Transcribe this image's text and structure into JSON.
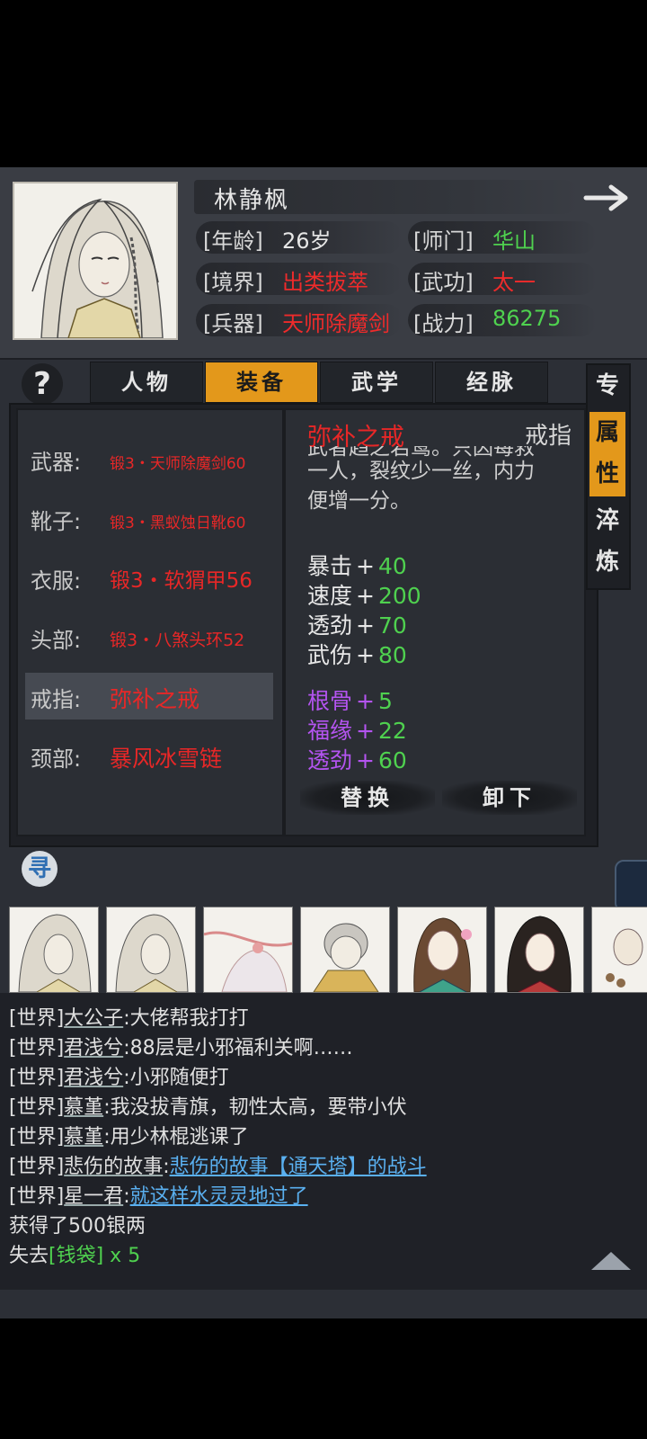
{
  "character": {
    "name": "林静枫",
    "stats": [
      {
        "label": "[年龄]",
        "value": "26岁",
        "color": "white"
      },
      {
        "label": "[师门]",
        "value": "华山",
        "color": "green"
      },
      {
        "label": "[境界]",
        "value": "出类拔萃",
        "color": "red"
      },
      {
        "label": "[武功]",
        "value": "太一",
        "color": "red"
      },
      {
        "label": "[兵器]",
        "value": "天师除魔剑",
        "color": "red"
      },
      {
        "label": "[战力]",
        "value": "86275",
        "color": "green"
      }
    ],
    "next_icon": "arrow-right-icon"
  },
  "tabs": [
    {
      "label": "人物",
      "active": false
    },
    {
      "label": "装备",
      "active": true
    },
    {
      "label": "武学",
      "active": false
    },
    {
      "label": "经脉",
      "active": false
    }
  ],
  "help_label": "?",
  "side_tabs": [
    {
      "label": "专",
      "active": false
    },
    {
      "label": "属性",
      "active": true
    },
    {
      "label": "淬炼",
      "active": false
    }
  ],
  "equipment": [
    {
      "slot": "武器:",
      "item": "锻3・天师除魔剑60"
    },
    {
      "slot": "靴子:",
      "item": "锻3・黑蚁蚀日靴60"
    },
    {
      "slot": "衣服:",
      "item": "锻3・软猬甲56"
    },
    {
      "slot": "头部:",
      "item": "锻3・八煞头环52"
    },
    {
      "slot": "戒指:",
      "item": "弥补之戒"
    },
    {
      "slot": "颈部:",
      "item": "暴风冰雪链"
    }
  ],
  "selected_slot": "戒指:",
  "detail": {
    "name": "弥补之戒",
    "type": "戒指",
    "desc_clipped": "武者趋之若鹜。只因每救",
    "desc_lines": [
      "一人，裂纹少一丝，内力",
      "便增一分。"
    ],
    "bonuses": [
      {
        "label": "暴击",
        "plus": "+",
        "value": "40"
      },
      {
        "label": "速度",
        "plus": "+",
        "value": "200"
      },
      {
        "label": "透劲",
        "plus": "+",
        "value": "70"
      },
      {
        "label": "武伤",
        "plus": "+",
        "value": "80"
      }
    ],
    "extra_bonuses": [
      {
        "label": "根骨",
        "plus": "+",
        "value": "5"
      },
      {
        "label": "福缘",
        "plus": "+",
        "value": "22"
      },
      {
        "label": "透劲",
        "plus": "+",
        "value": "60"
      }
    ],
    "replace_label": "替换",
    "unequip_label": "卸下"
  },
  "seek_label": "寻",
  "chat": [
    {
      "channel": "[世界]",
      "user": "大公子",
      "text": ":大佬帮我打打",
      "link": ""
    },
    {
      "channel": "[世界]",
      "user": "君浅兮",
      "text": ":88层是小邪福利关啊……",
      "link": ""
    },
    {
      "channel": "[世界]",
      "user": "君浅兮",
      "text": ":小邪随便打",
      "link": ""
    },
    {
      "channel": "[世界]",
      "user": "慕堇",
      "text": ":我没拔青旗，韧性太高，要带小伏",
      "link": ""
    },
    {
      "channel": "[世界]",
      "user": "慕堇",
      "text": ":用少林棍逃课了",
      "link": ""
    },
    {
      "channel": "[世界]",
      "user": "悲伤的故事",
      "text": ":",
      "link": "悲伤的故事【通天塔】的战斗"
    },
    {
      "channel": "[世界]",
      "user": "星一君",
      "text": ":",
      "link": "就这样水灵灵地过了"
    }
  ],
  "system_msgs": {
    "gain": "获得了500银两",
    "lose_prefix": "失去",
    "lose_item": "[钱袋]",
    "lose_count": " x 5"
  },
  "colors": {
    "accent": "#e3981b",
    "red": "#e82727",
    "green": "#4fd14f",
    "purple": "#b454f0",
    "link": "#5ab0f0"
  }
}
